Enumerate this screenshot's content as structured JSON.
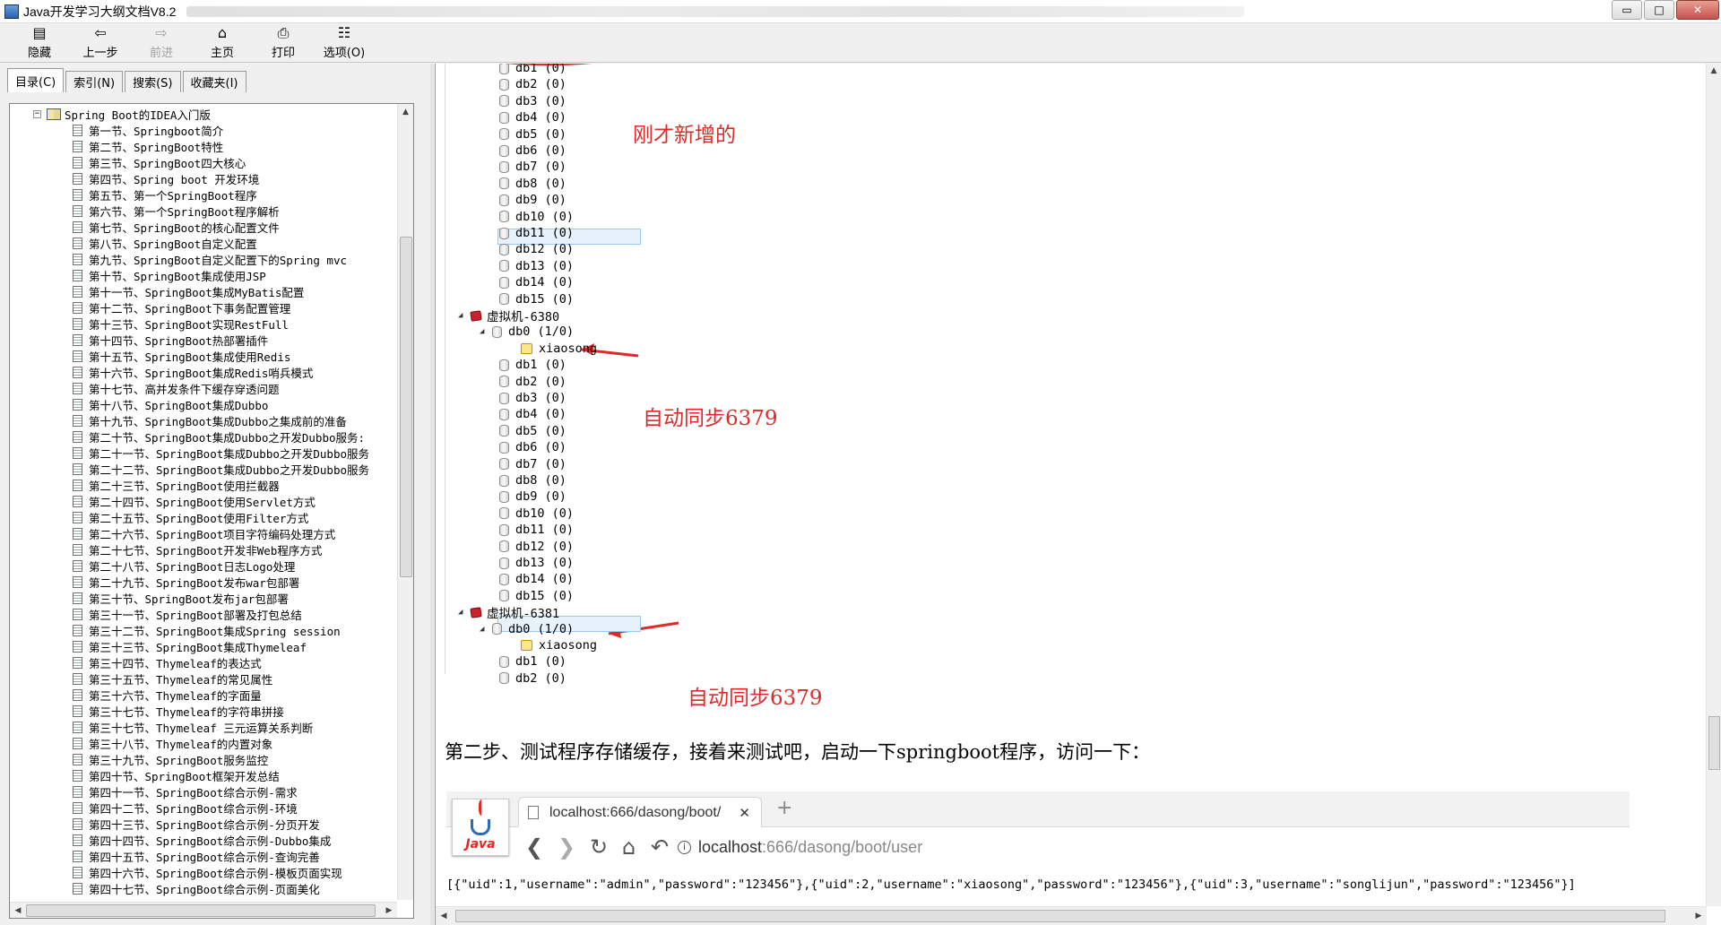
{
  "window": {
    "title": "Java开发学习大纲文档V8.2",
    "controls": {
      "minimize": "▭",
      "maximize": "□",
      "close": "✕"
    }
  },
  "toolbar": {
    "items": [
      {
        "label": "隐藏",
        "icon": "hide-icon",
        "glyph": "▤"
      },
      {
        "label": "上一步",
        "icon": "back-arrow-icon",
        "glyph": "⇦"
      },
      {
        "label": "前进",
        "icon": "forward-arrow-icon",
        "glyph": "⇨"
      },
      {
        "label": "主页",
        "icon": "home-icon",
        "glyph": "⌂"
      },
      {
        "label": "打印",
        "icon": "print-icon",
        "glyph": "⎙"
      },
      {
        "label": "选项(O)",
        "icon": "options-icon",
        "glyph": "☷"
      }
    ]
  },
  "nav_tabs": [
    "目录(C)",
    "索引(N)",
    "搜索(S)",
    "收藏夹(I)"
  ],
  "toc": {
    "root": "Spring Boot的IDEA入门版",
    "items": [
      "第一节、Springboot简介",
      "第二节、SpringBoot特性",
      "第三节、SpringBoot四大核心",
      "第四节、Spring boot 开发环境",
      "第五节、第一个SpringBoot程序",
      "第六节、第一个SpringBoot程序解析",
      "第七节、SpringBoot的核心配置文件",
      "第八节、SpringBoot自定义配置",
      "第九节、SpringBoot自定义配置下的Spring mvc",
      "第十节、SpringBoot集成使用JSP",
      "第十一节、SpringBoot集成MyBatis配置",
      "第十二节、SpringBoot下事务配置管理",
      "第十三节、SpringBoot实现RestFull",
      "第十四节、SpringBoot热部署插件",
      "第十五节、SpringBoot集成使用Redis",
      "第十六节、SpringBoot集成Redis哨兵模式",
      "第十七节、高并发条件下缓存穿透问题",
      "第十八节、SpringBoot集成Dubbo",
      "第十九节、SpringBoot集成Dubbo之集成前的准备",
      "第二十节、SpringBoot集成Dubbo之开发Dubbo服务:",
      "第二十一节、SpringBoot集成Dubbo之开发Dubbo服务",
      "第二十二节、SpringBoot集成Dubbo之开发Dubbo服务",
      "第二十三节、SpringBoot使用拦截器",
      "第二十四节、SpringBoot使用Servlet方式",
      "第二十五节、SpringBoot使用Filter方式",
      "第二十六节、SpringBoot项目字符编码处理方式",
      "第二十七节、SpringBoot开发非Web程序方式",
      "第二十八节、SpringBoot日志Logo处理",
      "第二十九节、SpringBoot发布war包部署",
      "第三十节、SpringBoot发布jar包部署",
      "第三十一节、SpringBoot部署及打包总结",
      "第三十二节、SpringBoot集成Spring session",
      "第三十三节、SpringBoot集成Thymeleaf",
      "第三十四节、Thymeleaf的表达式",
      "第三十五节、Thymeleaf的常见属性",
      "第三十六节、Thymeleaf的字面量",
      "第三十七节、Thymeleaf的字符串拼接",
      "第三十七节、Thymeleaf 三元运算关系判断",
      "第三十八节、Thymeleaf的内置对象",
      "第三十九节、SpringBoot服务监控",
      "第四十节、SpringBoot框架开发总结",
      "第四十一节、SpringBoot综合示例-需求",
      "第四十二节、SpringBoot综合示例-环境",
      "第四十三节、SpringBoot综合示例-分页开发",
      "第四十四节、SpringBoot综合示例-Dubbo集成",
      "第四十五节、SpringBoot综合示例-查询完善",
      "第四十六节、SpringBoot综合示例-模板页面实现",
      "第四十七节、SpringBoot综合示例-页面美化"
    ]
  },
  "redis_tree": {
    "top_dbs": [
      "db1  (0)",
      "db2  (0)",
      "db3  (0)",
      "db4  (0)",
      "db5  (0)",
      "db6  (0)",
      "db7  (0)",
      "db8  (0)",
      "db9  (0)",
      "db10  (0)",
      "db11  (0)",
      "db12  (0)",
      "db13  (0)",
      "db14  (0)",
      "db15  (0)"
    ],
    "server2": "虚拟机-6380",
    "server2_db0": "db0   (1/0)",
    "server2_key": "xiaosong",
    "server2_dbs": [
      "db1  (0)",
      "db2  (0)",
      "db3  (0)",
      "db4  (0)",
      "db5  (0)",
      "db6  (0)",
      "db7  (0)",
      "db8  (0)",
      "db9  (0)",
      "db10  (0)",
      "db11  (0)",
      "db12  (0)",
      "db13  (0)",
      "db14  (0)",
      "db15  (0)"
    ],
    "server3": "虚拟机-6381",
    "server3_db0": "db0   (1/0)",
    "server3_key": "xiaosong",
    "server3_dbs": [
      "db1  (0)",
      "db2  (0)"
    ]
  },
  "annotations": {
    "new_added": "刚才新增的",
    "sync1": "自动同步6379",
    "sync2": "自动同步6379"
  },
  "paragraph": "第二步、测试程序存储缓存，接着来测试吧，启动一下springboot程序，访问一下：",
  "browser": {
    "logo_text": "Java",
    "tab_title": "localhost:666/dasong/boot/",
    "tab_close": "✕",
    "new_tab": "+",
    "url_host": "localhost",
    "url_path": ":666/dasong/boot/user",
    "response": "[{\"uid\":1,\"username\":\"admin\",\"password\":\"123456\"},{\"uid\":2,\"username\":\"xiaosong\",\"password\":\"123456\"},{\"uid\":3,\"username\":\"songlijun\",\"password\":\"123456\"}]"
  }
}
